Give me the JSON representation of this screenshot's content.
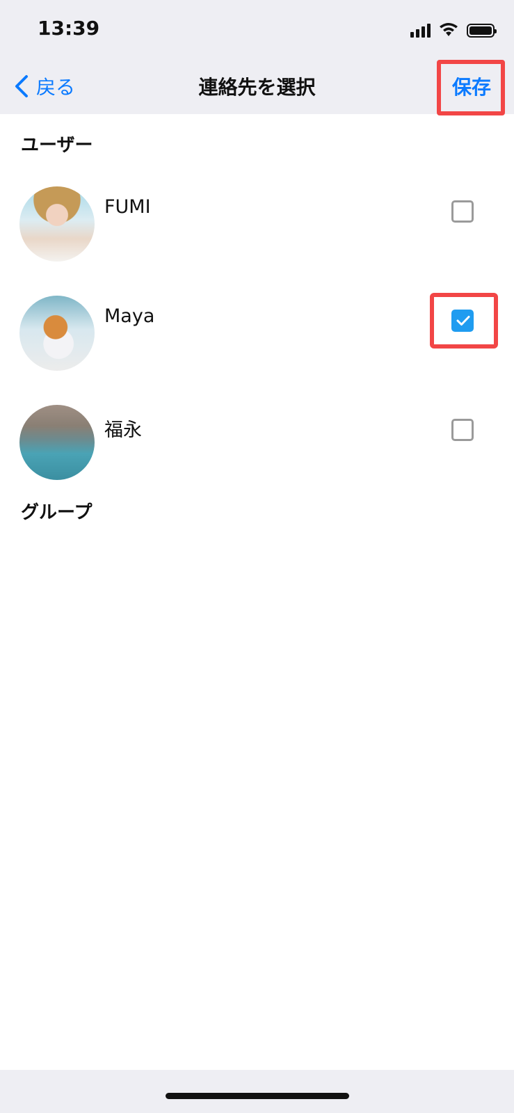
{
  "status_bar": {
    "time": "13:39"
  },
  "nav": {
    "back_label": "戻る",
    "title": "連絡先を選択",
    "save_label": "保存"
  },
  "sections": {
    "users_header": "ユーザー",
    "groups_header": "グループ"
  },
  "users": [
    {
      "name": "FUMI",
      "checked": false
    },
    {
      "name": "Maya",
      "checked": true
    },
    {
      "name": "福永",
      "checked": false
    }
  ],
  "colors": {
    "accent": "#0a7aff",
    "checkbox_checked": "#1f9cf0",
    "highlight": "#f24646",
    "nav_background": "#eeeef3"
  }
}
